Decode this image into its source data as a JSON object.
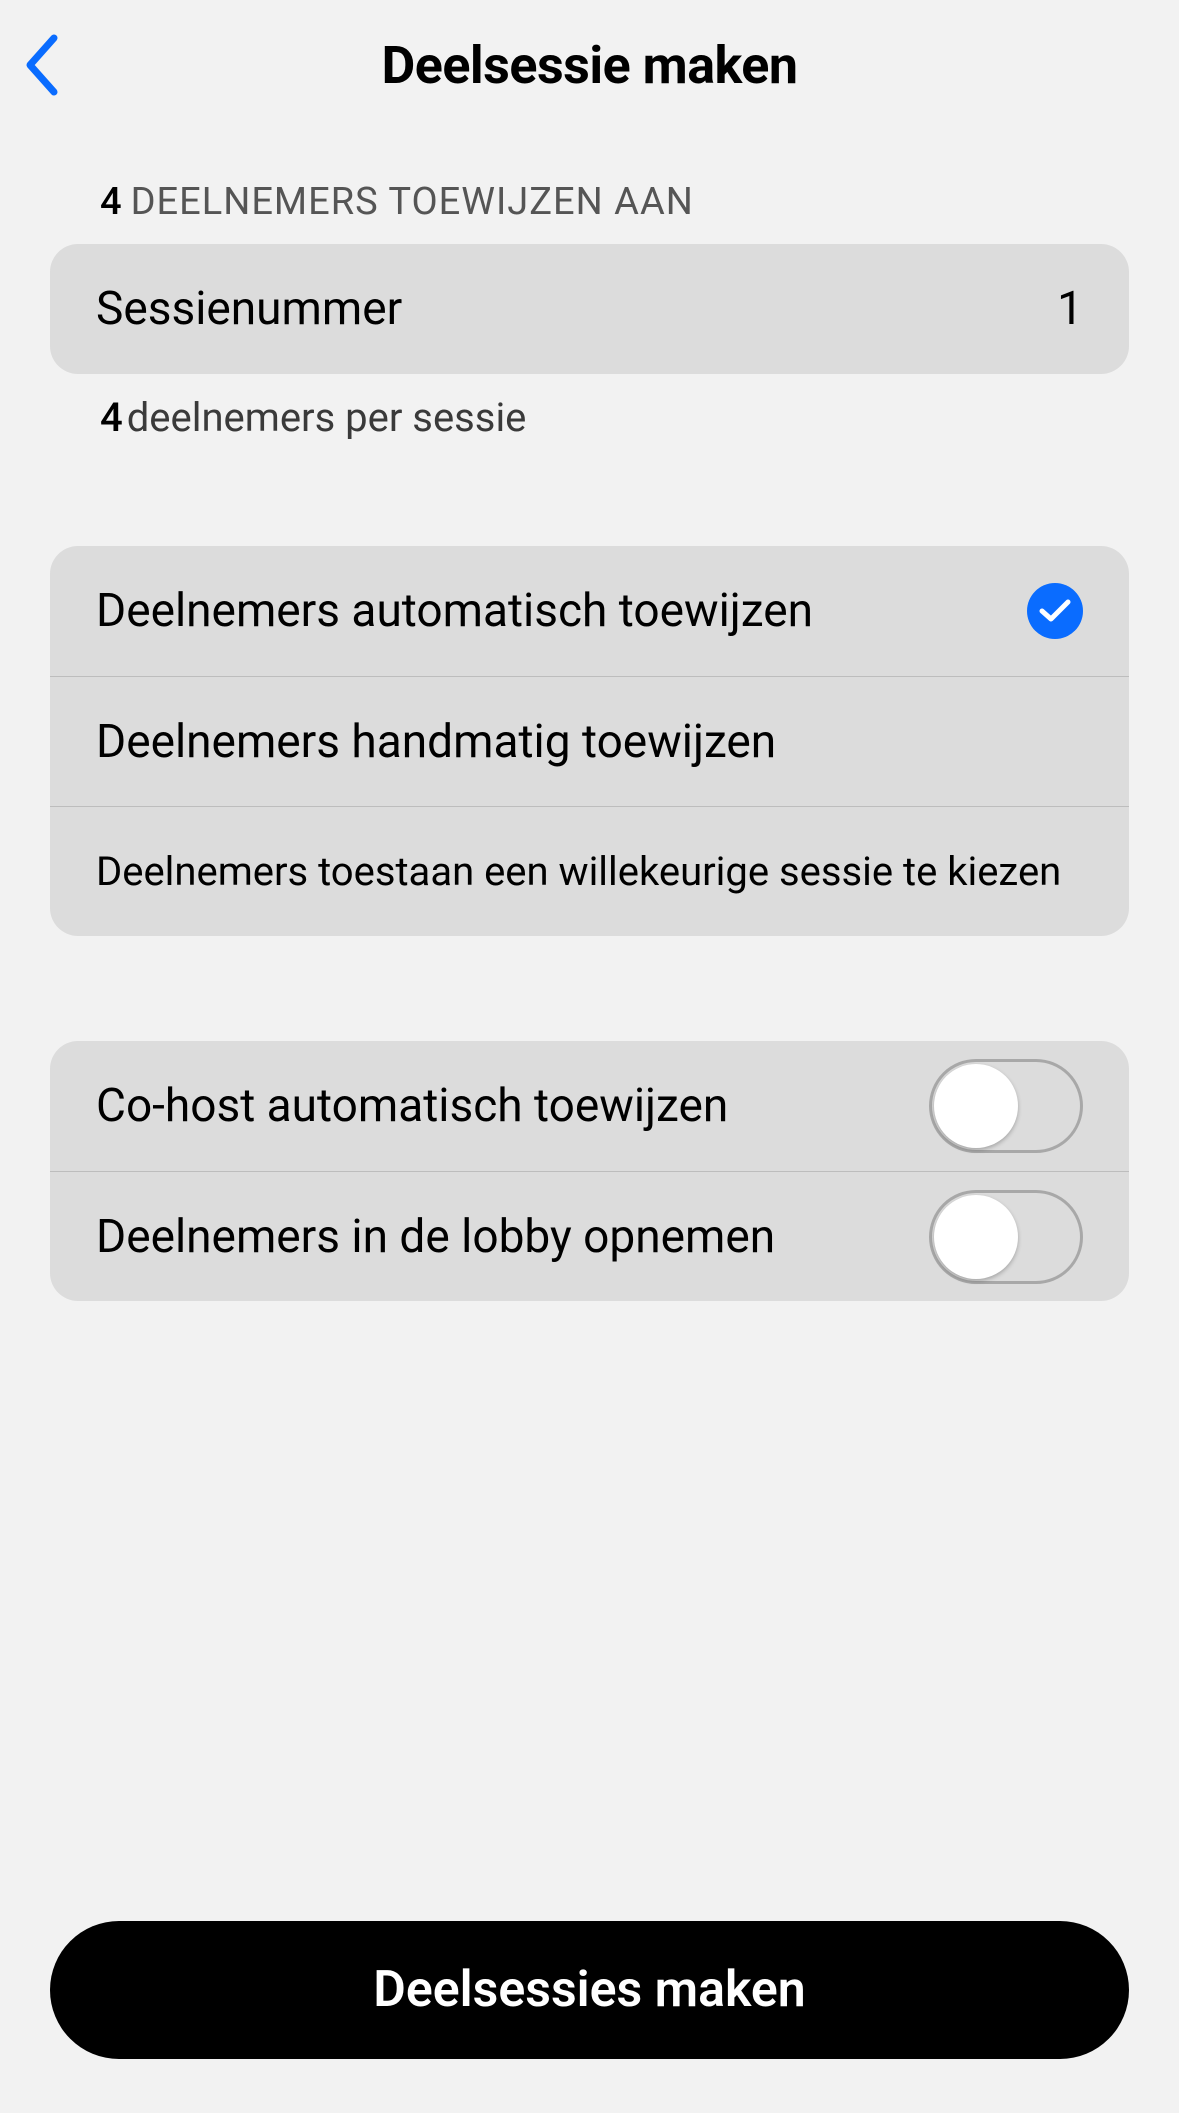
{
  "colors": {
    "accent": "#0a6cff",
    "primaryButtonBg": "#000000"
  },
  "header": {
    "title": "Deelsessie maken"
  },
  "section1": {
    "lead_count": "4",
    "header_text": "DEELNEMERS TOEWIJZEN AAN",
    "session_label": "Sessienummer",
    "session_value": "1",
    "footer_count": "4",
    "footer_text": "deelnemers per sessie"
  },
  "assignment": {
    "auto_label": "Deelnemers automatisch toewijzen",
    "auto_selected": true,
    "manual_label": "Deelnemers handmatig toewijzen",
    "allow_choose_label": "Deelnemers toestaan een willekeurige sessie te kiezen"
  },
  "toggles": {
    "cohost_label": "Co-host automatisch toewijzen",
    "cohost_on": false,
    "lobby_label": "Deelnemers in de lobby opnemen",
    "lobby_on": false
  },
  "footer_button": "Deelsessies maken"
}
